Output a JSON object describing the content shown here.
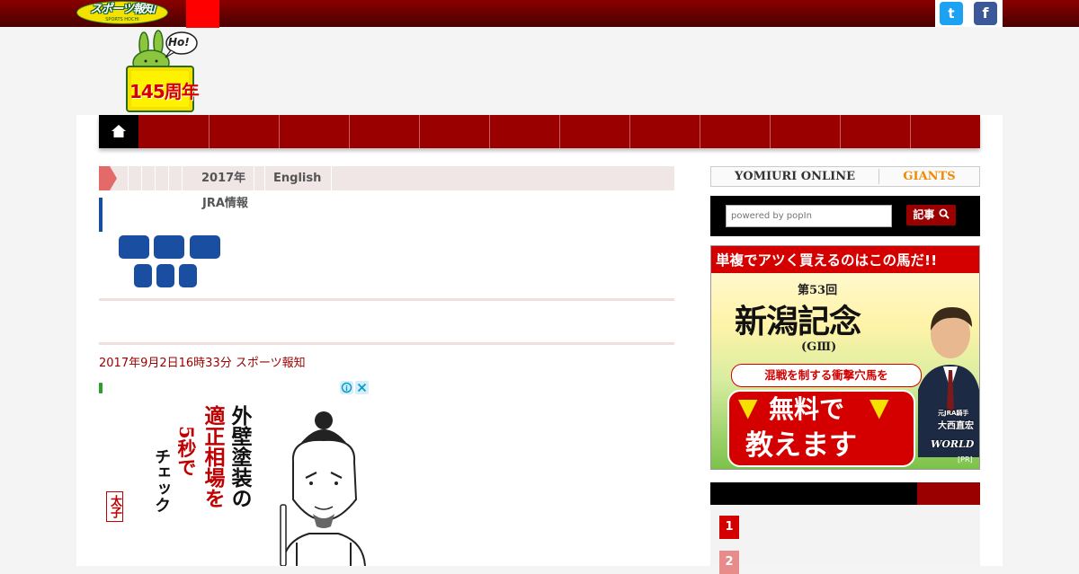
{
  "header": {
    "logo_text": "スポーツ報知",
    "logo_subtext": "SPORTS HOCHI",
    "social": {
      "twitter_icon": "twitter-icon",
      "facebook_icon": "facebook-icon"
    },
    "mascot": {
      "speech": "Ho!",
      "anniversary": "145周年"
    }
  },
  "nav": {
    "home_icon": "home-icon",
    "items": [
      "",
      "",
      "",
      "",
      "",
      "",
      "",
      "",
      "",
      "",
      "",
      ""
    ],
    "labelled_items": [
      "",
      ""
    ]
  },
  "breadcrumb": {
    "date": "2017年",
    "english": "English",
    "jra": "JRA情報"
  },
  "article": {
    "title": "",
    "date": "2017年9月2日16時33分 スポーツ報知",
    "paragraphs": [
      "",
      ""
    ]
  },
  "ad": {
    "line1": "外壁塗装の",
    "line2": "適正相場を",
    "line3": "5秒で",
    "line4": "チェック",
    "stamp": "太子"
  },
  "sidebar": {
    "yomiuri": "YOMIURI ONLINE",
    "giants": "GIANTS",
    "search_placeholder": "powered by popIn",
    "search_button": "記事",
    "banner": {
      "headline": "単複でアツく買えるのはこの馬だ!!",
      "race_number": "第53回",
      "race_name": "新潟記念",
      "grade": "(GⅢ)",
      "copy1": "混戦を制する衝撃穴馬を",
      "copy2": "無料で",
      "copy3": "教えます",
      "person_title": "元JRA騎手",
      "person_name": "大西直宏",
      "brand": "WORLD",
      "pr": "[PR]"
    },
    "ranking": [
      "1",
      "2"
    ]
  },
  "colors": {
    "brand_red": "#9a0000",
    "share_blue": "#1a4ea0",
    "accent_yellow": "#f5e100"
  }
}
